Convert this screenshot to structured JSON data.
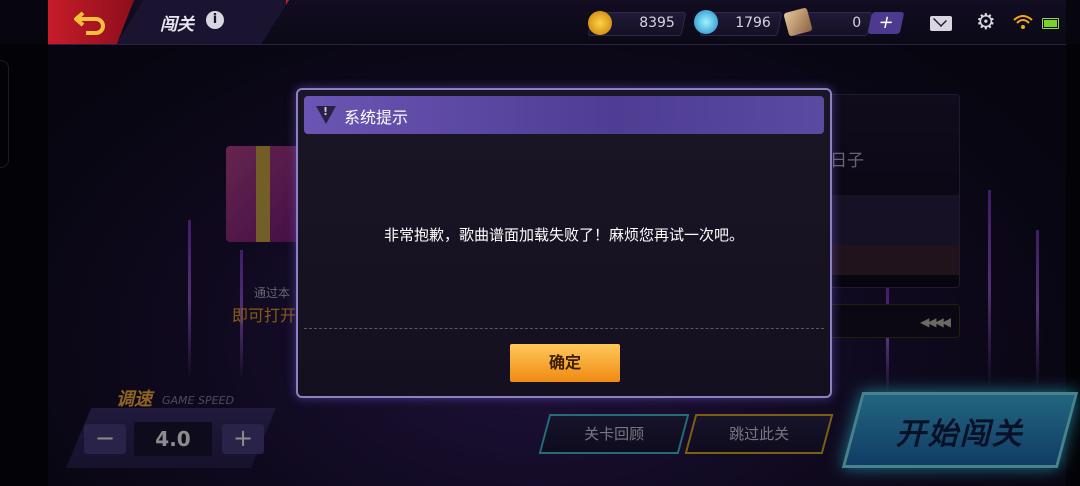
{
  "header": {
    "title": "闯关",
    "resources": [
      {
        "name": "gold-coin",
        "value": "8395",
        "color": "#f5a623"
      },
      {
        "name": "diamond",
        "value": "1796",
        "color": "#38c4f0"
      },
      {
        "name": "ticket",
        "value": "0",
        "color": "#c8a070"
      }
    ],
    "plus_label": "+"
  },
  "background": {
    "song_fragment": "日子",
    "gift_text_line1": "通过本",
    "gift_text_line2": "即可打开",
    "arrows": "◀◀◀◀"
  },
  "speed": {
    "label": "调速",
    "label_en": "GAME SPEED",
    "minus": "−",
    "value": "4.0",
    "plus": "+"
  },
  "buttons": {
    "review": "关卡回顾",
    "skip": "跳过此关",
    "start": "开始闯关"
  },
  "dialog": {
    "title": "系统提示",
    "message": "非常抱歉，歌曲谱面加载失败了！麻烦您再试一次吧。",
    "confirm": "确定"
  }
}
